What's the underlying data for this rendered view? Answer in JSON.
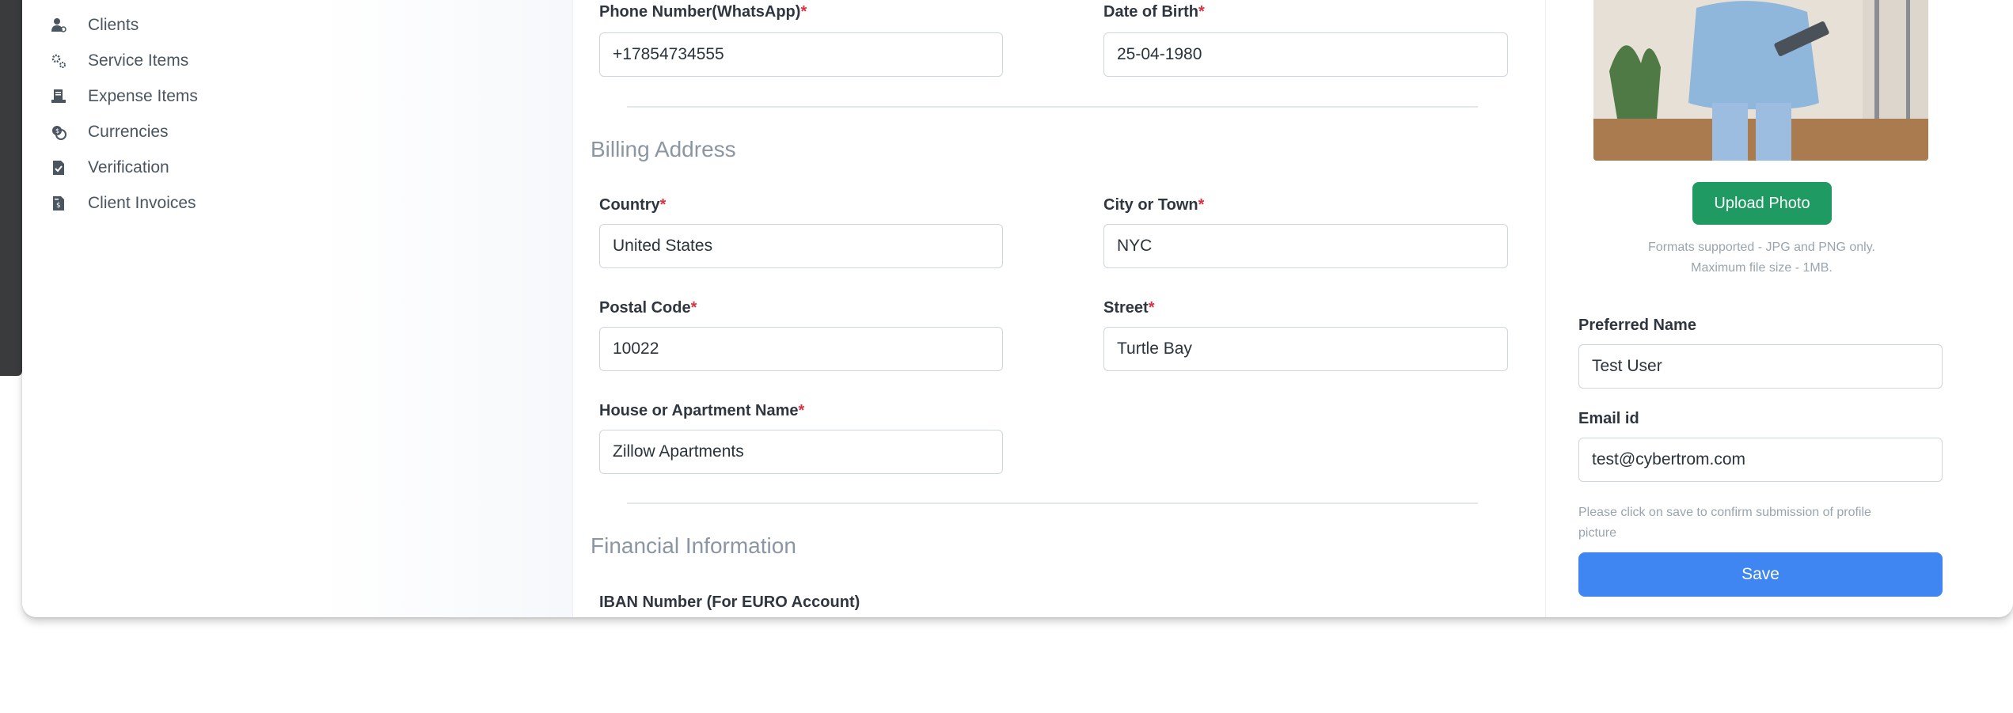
{
  "sidebar": {
    "items": [
      {
        "label": "Clients",
        "icon": "clients-icon"
      },
      {
        "label": "Service Items",
        "icon": "service-gears-icon"
      },
      {
        "label": "Expense Items",
        "icon": "receipt-icon"
      },
      {
        "label": "Currencies",
        "icon": "currency-icon"
      },
      {
        "label": "Verification",
        "icon": "verification-doc-icon"
      },
      {
        "label": "Client Invoices",
        "icon": "invoice-icon"
      }
    ]
  },
  "form": {
    "phone": {
      "label": "Phone Number(WhatsApp)",
      "value": "+17854734555"
    },
    "dob": {
      "label": "Date of Birth",
      "value": "25-04-1980"
    },
    "billing_title": "Billing Address",
    "country": {
      "label": "Country",
      "value": "United States"
    },
    "city": {
      "label": "City or Town",
      "value": "NYC"
    },
    "postal": {
      "label": "Postal Code",
      "value": "10022"
    },
    "street": {
      "label": "Street",
      "value": "Turtle Bay"
    },
    "house": {
      "label": "House or Apartment Name",
      "value": "Zillow Apartments"
    },
    "financial_title": "Financial Information",
    "iban": {
      "label": "IBAN Number (For EURO Account)"
    },
    "required_mark": "*"
  },
  "profile": {
    "upload_label": "Upload Photo",
    "formats_hint": "Formats supported - JPG and PNG only.",
    "size_hint": "Maximum file size - 1MB.",
    "preferred_name_label": "Preferred Name",
    "preferred_name_value": "Test User",
    "email_label": "Email id",
    "email_value": "test@cybertrom.com",
    "save_hint_line1": "Please click on save to confirm submission of profile",
    "save_hint_line2": "picture",
    "save_label": "Save"
  },
  "colors": {
    "upload": "#1f9a62",
    "save": "#3f86f2",
    "required": "#e03040",
    "sidebar_dark": "#3a3b3d"
  }
}
